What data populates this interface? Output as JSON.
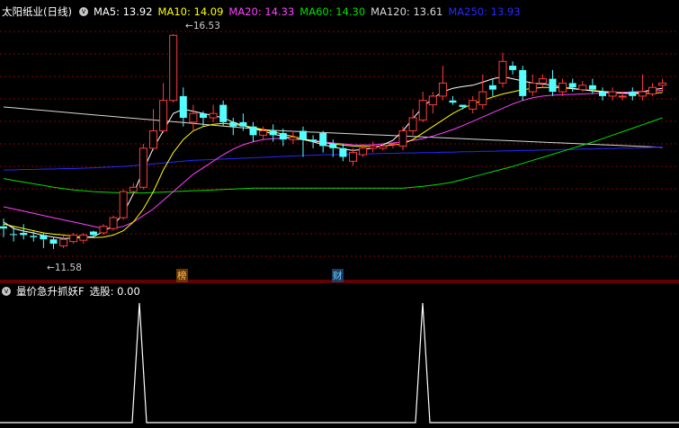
{
  "main_legend": {
    "stock_title": "太阳纸业(日线)",
    "ma5": "MA5: 13.92",
    "ma10": "MA10: 14.09",
    "ma20": "MA20: 14.33",
    "ma60": "MA60: 14.30",
    "ma120": "MA120: 13.61",
    "ma250": "MA250: 13.93"
  },
  "annotations": {
    "high_label": "16.53",
    "low_label": "11.58",
    "marker_bang": "榜",
    "marker_cai": "财"
  },
  "indicator": {
    "name": "量价急升抓妖F",
    "value_label": "选股: 0.00"
  },
  "colors": {
    "up": "#ff3c3c",
    "down": "#54ffff",
    "ma5": "#ffffff",
    "ma10": "#ffff00",
    "ma20": "#ff40ff",
    "ma60": "#00e000",
    "ma120": "#d8d8d8",
    "ma250": "#2828ff",
    "grid": "#8a0000",
    "border": "#c00000"
  },
  "chart_data": [
    {
      "type": "candlestick",
      "title": "太阳纸业(日线)",
      "price_range": [
        11.1,
        16.9
      ],
      "max_label": 16.53,
      "min_label": 11.58,
      "candles": [
        [
          12.1,
          12.05,
          12.28,
          11.85
        ],
        [
          11.92,
          11.9,
          12.1,
          11.75
        ],
        [
          11.95,
          11.9,
          12.15,
          11.8
        ],
        [
          11.88,
          11.85,
          11.98,
          11.75
        ],
        [
          11.9,
          11.8,
          11.95,
          11.6
        ],
        [
          11.8,
          11.7,
          11.85,
          11.58
        ],
        [
          11.65,
          11.8,
          11.9,
          11.6
        ],
        [
          11.75,
          11.9,
          11.95,
          11.7
        ],
        [
          11.78,
          11.9,
          11.95,
          11.7
        ],
        [
          11.98,
          11.9,
          12.0,
          11.85
        ],
        [
          11.95,
          12.1,
          12.15,
          11.9
        ],
        [
          12.05,
          12.3,
          12.35,
          12.0
        ],
        [
          12.3,
          12.9,
          12.95,
          12.25
        ],
        [
          12.9,
          13.0,
          13.1,
          12.85
        ],
        [
          13.0,
          13.9,
          14.0,
          12.95
        ],
        [
          13.9,
          14.3,
          14.8,
          13.85
        ],
        [
          14.3,
          15.0,
          15.4,
          14.25
        ],
        [
          15.0,
          16.5,
          16.53,
          14.95
        ],
        [
          15.1,
          14.6,
          15.3,
          14.4
        ],
        [
          14.5,
          14.7,
          14.9,
          14.3
        ],
        [
          14.7,
          14.6,
          14.75,
          14.4
        ],
        [
          14.6,
          14.7,
          14.9,
          14.5
        ],
        [
          14.9,
          14.5,
          15.0,
          14.4
        ],
        [
          14.5,
          14.4,
          14.6,
          14.2
        ],
        [
          14.5,
          14.4,
          14.7,
          14.3
        ],
        [
          14.4,
          14.2,
          14.5,
          14.05
        ],
        [
          14.2,
          14.3,
          14.4,
          14.1
        ],
        [
          14.3,
          14.2,
          14.45,
          14.05
        ],
        [
          14.25,
          14.1,
          14.35,
          13.95
        ],
        [
          14.1,
          14.15,
          14.3,
          14.0
        ],
        [
          14.3,
          14.1,
          14.4,
          13.7
        ],
        [
          14.1,
          14.05,
          14.2,
          13.9
        ],
        [
          14.25,
          13.95,
          14.3,
          13.8
        ],
        [
          14.0,
          13.9,
          14.1,
          13.7
        ],
        [
          13.9,
          13.7,
          14.0,
          13.6
        ],
        [
          13.6,
          13.8,
          13.9,
          13.5
        ],
        [
          13.75,
          13.9,
          14.0,
          13.7
        ],
        [
          13.9,
          13.95,
          14.05,
          13.8
        ],
        [
          13.9,
          13.95,
          14.0,
          13.85
        ],
        [
          14.0,
          14.0,
          14.0,
          13.9
        ],
        [
          13.95,
          14.3,
          14.4,
          13.85
        ],
        [
          14.3,
          14.6,
          14.8,
          14.2
        ],
        [
          14.55,
          15.0,
          15.2,
          14.5
        ],
        [
          14.9,
          15.1,
          15.2,
          14.7
        ],
        [
          15.1,
          15.4,
          15.8,
          15.0
        ],
        [
          15.0,
          14.95,
          15.1,
          14.9
        ],
        [
          14.9,
          14.85,
          14.9,
          14.8
        ],
        [
          14.8,
          15.0,
          15.1,
          14.7
        ],
        [
          14.9,
          15.2,
          15.6,
          14.8
        ],
        [
          15.35,
          15.25,
          15.5,
          15.1
        ],
        [
          15.4,
          15.9,
          16.1,
          15.3
        ],
        [
          15.8,
          15.7,
          15.9,
          15.6
        ],
        [
          15.7,
          15.1,
          15.8,
          15.0
        ],
        [
          15.2,
          15.4,
          15.6,
          15.1
        ],
        [
          15.4,
          15.5,
          15.6,
          15.3
        ],
        [
          15.5,
          15.2,
          15.7,
          15.1
        ],
        [
          15.2,
          15.4,
          15.5,
          15.1
        ],
        [
          15.4,
          15.3,
          15.5,
          15.2
        ],
        [
          15.25,
          15.35,
          15.45,
          15.2
        ],
        [
          15.35,
          15.25,
          15.5,
          15.15
        ],
        [
          15.2,
          15.1,
          15.3,
          15.0
        ],
        [
          15.1,
          15.2,
          15.3,
          15.0
        ],
        [
          15.1,
          15.1,
          15.2,
          15.0
        ],
        [
          15.2,
          15.1,
          15.3,
          15.0
        ],
        [
          15.1,
          15.2,
          15.6,
          15.0
        ],
        [
          15.15,
          15.3,
          15.4,
          15.1
        ],
        [
          15.35,
          15.4,
          15.5,
          15.2
        ]
      ],
      "ma5": [
        12.2,
        12.05,
        11.99,
        11.95,
        11.89,
        11.85,
        11.82,
        11.83,
        11.85,
        11.86,
        11.98,
        12.12,
        12.4,
        12.85,
        13.4,
        13.9,
        14.3,
        14.7,
        14.8,
        14.75,
        14.7,
        14.65,
        14.6,
        14.5,
        14.42,
        14.35,
        14.3,
        14.22,
        14.18,
        14.12,
        14.1,
        14.05,
        13.98,
        13.93,
        13.88,
        13.85,
        13.87,
        13.9,
        13.98,
        14.08,
        14.3,
        14.58,
        14.85,
        15.05,
        15.2,
        15.28,
        15.32,
        15.35,
        15.42,
        15.5,
        15.55,
        15.5,
        15.45,
        15.4,
        15.38,
        15.35,
        15.3,
        15.28,
        15.25,
        15.22,
        15.2,
        15.18,
        15.17,
        15.16,
        15.2,
        15.25,
        15.28
      ],
      "ma10": [
        12.15,
        12.1,
        12.05,
        12.0,
        11.95,
        11.92,
        11.9,
        11.87,
        11.85,
        11.84,
        11.85,
        11.9,
        12.0,
        12.2,
        12.5,
        12.9,
        13.4,
        13.8,
        14.1,
        14.3,
        14.4,
        14.45,
        14.47,
        14.45,
        14.42,
        14.38,
        14.33,
        14.28,
        14.22,
        14.17,
        14.12,
        14.07,
        14.03,
        14.0,
        13.97,
        13.95,
        13.94,
        13.94,
        13.95,
        13.97,
        14.0,
        14.1,
        14.25,
        14.4,
        14.55,
        14.7,
        14.82,
        14.92,
        15.0,
        15.08,
        15.15,
        15.2,
        15.25,
        15.28,
        15.3,
        15.3,
        15.29,
        15.27,
        15.25,
        15.23,
        15.21,
        15.19,
        15.17,
        15.16,
        15.16,
        15.17,
        15.18
      ],
      "ma20": [
        12.55,
        12.5,
        12.45,
        12.4,
        12.35,
        12.3,
        12.25,
        12.2,
        12.15,
        12.1,
        12.05,
        12.05,
        12.1,
        12.2,
        12.35,
        12.5,
        12.7,
        12.9,
        13.1,
        13.3,
        13.45,
        13.6,
        13.75,
        13.88,
        13.98,
        14.05,
        14.1,
        14.12,
        14.13,
        14.12,
        14.1,
        14.08,
        14.05,
        14.02,
        14.0,
        13.98,
        13.97,
        13.98,
        14.0,
        14.02,
        14.05,
        14.08,
        14.12,
        14.18,
        14.25,
        14.33,
        14.42,
        14.52,
        14.62,
        14.72,
        14.82,
        14.92,
        15.0,
        15.06,
        15.1,
        15.12,
        15.13,
        15.14,
        15.15,
        15.16,
        15.17,
        15.18,
        15.19,
        15.2,
        15.21,
        15.22,
        15.23
      ],
      "ma60": [
        13.2,
        13.16,
        13.12,
        13.08,
        13.04,
        13.0,
        12.97,
        12.94,
        12.92,
        12.9,
        12.89,
        12.88,
        12.87,
        12.87,
        12.87,
        12.88,
        12.89,
        12.9,
        12.91,
        12.92,
        12.93,
        12.94,
        12.95,
        12.96,
        12.97,
        12.98,
        12.98,
        12.98,
        12.98,
        12.98,
        12.98,
        12.98,
        12.98,
        12.98,
        12.98,
        12.98,
        12.98,
        12.98,
        12.98,
        12.98,
        12.98,
        13.0,
        13.02,
        13.05,
        13.08,
        13.12,
        13.18,
        13.24,
        13.3,
        13.36,
        13.42,
        13.48,
        13.55,
        13.62,
        13.69,
        13.76,
        13.83,
        13.9,
        13.97,
        14.04,
        14.12,
        14.2,
        14.28,
        14.36,
        14.44,
        14.52,
        14.6
      ],
      "ma120": [
        14.85,
        14.83,
        14.81,
        14.79,
        14.77,
        14.75,
        14.73,
        14.71,
        14.69,
        14.67,
        14.65,
        14.63,
        14.61,
        14.59,
        14.57,
        14.55,
        14.53,
        14.51,
        14.49,
        14.47,
        14.45,
        14.43,
        14.41,
        14.39,
        14.37,
        14.35,
        14.33,
        14.31,
        14.3,
        14.29,
        14.28,
        14.27,
        14.26,
        14.25,
        14.24,
        14.23,
        14.22,
        14.21,
        14.2,
        14.19,
        14.18,
        14.17,
        14.16,
        14.15,
        14.14,
        14.13,
        14.12,
        14.11,
        14.1,
        14.09,
        14.08,
        14.07,
        14.06,
        14.05,
        14.04,
        14.03,
        14.02,
        14.01,
        14.0,
        13.99,
        13.98,
        13.97,
        13.96,
        13.95,
        13.94,
        13.93,
        13.92
      ],
      "ma250": [
        13.4,
        13.4,
        13.41,
        13.41,
        13.42,
        13.42,
        13.43,
        13.43,
        13.44,
        13.45,
        13.46,
        13.47,
        13.48,
        13.5,
        13.52,
        13.54,
        13.56,
        13.58,
        13.6,
        13.62,
        13.63,
        13.64,
        13.65,
        13.66,
        13.67,
        13.68,
        13.69,
        13.7,
        13.71,
        13.72,
        13.73,
        13.74,
        13.75,
        13.75,
        13.76,
        13.76,
        13.77,
        13.77,
        13.78,
        13.78,
        13.79,
        13.79,
        13.8,
        13.8,
        13.81,
        13.81,
        13.82,
        13.82,
        13.83,
        13.83,
        13.84,
        13.84,
        13.85,
        13.85,
        13.86,
        13.86,
        13.87,
        13.87,
        13.88,
        13.88,
        13.89,
        13.89,
        13.9,
        13.9,
        13.91,
        13.92,
        13.93
      ]
    },
    {
      "type": "line",
      "title": "量价急升抓妖F",
      "series": [
        {
          "name": "选股",
          "values": [
            0,
            0,
            0,
            0,
            0,
            0,
            0,
            0,
            0,
            0,
            0,
            0,
            0,
            0,
            0,
            0,
            0,
            0,
            0,
            0,
            0,
            0,
            0,
            0,
            0,
            0,
            0,
            0,
            0,
            0,
            0,
            0,
            0,
            0,
            0,
            0,
            0,
            0,
            0,
            0,
            0,
            0,
            0,
            0,
            0,
            0,
            0,
            0,
            0,
            0,
            0,
            0,
            0,
            0,
            0,
            0,
            0,
            0,
            0,
            0,
            0,
            0,
            0,
            0,
            0,
            0,
            0
          ],
          "spikes": [
            [
              155,
              1
            ],
            [
              470,
              1
            ]
          ]
        }
      ],
      "ylim": [
        0,
        1
      ]
    }
  ]
}
